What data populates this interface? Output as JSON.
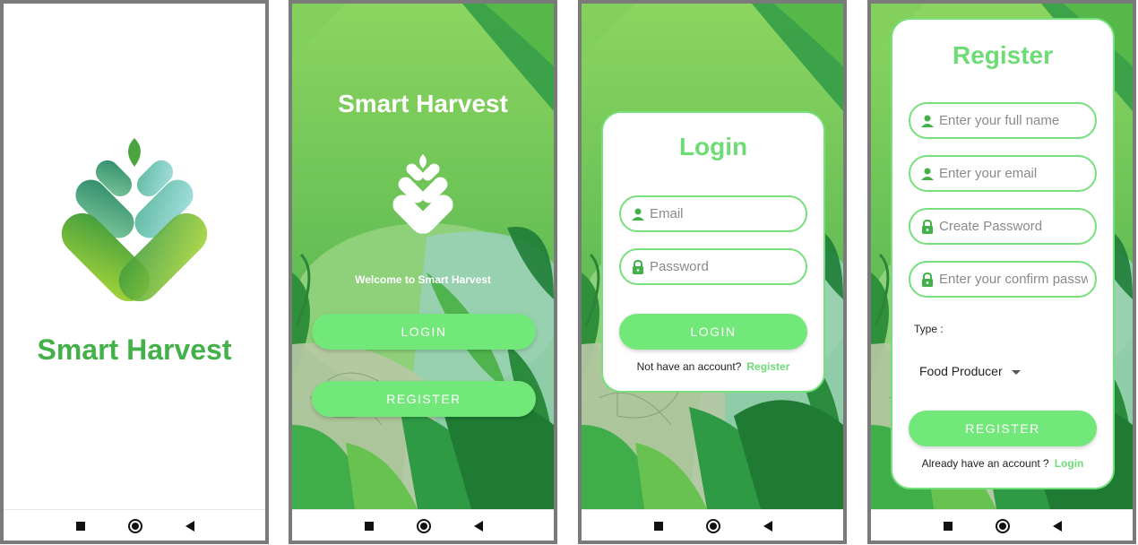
{
  "app_name": "Smart Harvest",
  "welcome": {
    "title": "Smart Harvest",
    "subtitle": "Welcome to Smart Harvest",
    "login_button": "LOGIN",
    "register_button": "REGISTER"
  },
  "login": {
    "title": "Login",
    "email_placeholder": "Email",
    "password_placeholder": "Password",
    "login_button": "LOGIN",
    "no_account_text": "Not have an account?",
    "register_link": "Register"
  },
  "register": {
    "title": "Register",
    "fullname_placeholder": "Enter your full name",
    "email_placeholder": "Enter your email",
    "password_placeholder": "Create Password",
    "confirm_placeholder": "Enter your confirm passw",
    "type_label": "Type :",
    "type_value": "Food Producer",
    "register_button": "REGISTER",
    "have_account_text": "Already have an account ?",
    "login_link": "Login"
  },
  "icons": {
    "user": "user-icon",
    "lock": "lock-icon",
    "nav_recents": "square-icon",
    "nav_home": "circle-icon",
    "nav_back": "back-triangle-icon"
  },
  "colors": {
    "brand_green": "#43b04a",
    "button_green": "#73e87a",
    "field_border": "#77e07d",
    "title_green": "#6ddc74",
    "link_green": "#6ddc74"
  }
}
